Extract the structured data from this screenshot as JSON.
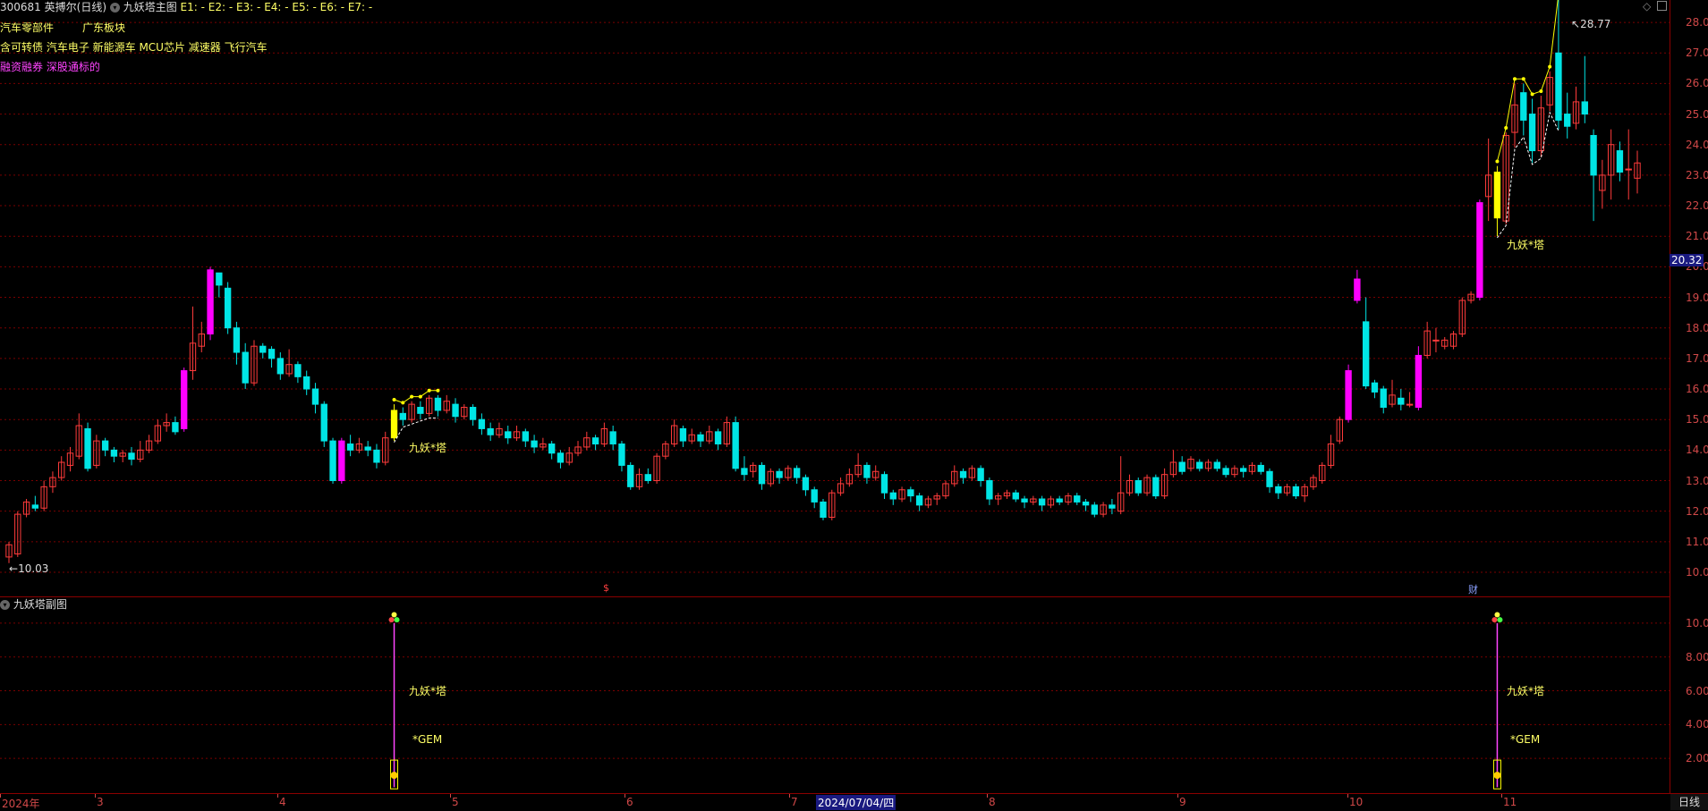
{
  "header": {
    "stock_code": "300681",
    "stock_name": "英搏尔",
    "period": "(日线)",
    "indicator": "九妖塔主图",
    "e_values": "E1: -  E2: -  E3: -  E4: -  E5: -  E6: -  E7: -"
  },
  "tags": {
    "row1a": "汽车零部件",
    "row1b": "广东板块",
    "row2": "含可转债 汽车电子 新能源车 MCU芯片 减速器 飞行汽车",
    "row3": "融资融券 深股通标的"
  },
  "colors": {
    "up": "#ff3b3b",
    "down": "#00e5e5",
    "limit_up": "#ff00ff",
    "signal": "#ffff00",
    "grid": "#7a0000",
    "axis_text": "#d04848"
  },
  "annotations": {
    "high_label": "28.77",
    "low_label": "10.03",
    "signal_label_1": "九妖*塔",
    "signal_label_2": "九妖*塔",
    "event_mark_1": "$",
    "event_mark_2": "财",
    "current_price": "20.32"
  },
  "sub_panel": {
    "title": "九妖塔副图",
    "signal_1_top": "九妖*塔",
    "signal_1_gem": "*GEM",
    "signal_2_top": "九妖*塔",
    "signal_2_gem": "*GEM",
    "axis_labels": [
      "10.00",
      "8.00",
      "6.00",
      "4.00",
      "2.00"
    ]
  },
  "price_axis": [
    "28.00",
    "27.00",
    "26.00",
    "25.00",
    "24.00",
    "23.00",
    "22.00",
    "21.00",
    "20.00",
    "19.00",
    "18.00",
    "17.00",
    "16.00",
    "15.00",
    "14.00",
    "13.00",
    "12.00",
    "11.00",
    "10.00"
  ],
  "date_axis": {
    "ticks": [
      "2024年",
      "3",
      "4",
      "5",
      "6",
      "7",
      "8",
      "9",
      "10",
      "11"
    ],
    "cursor_date": "2024/07/04/四",
    "period_button": "日线"
  },
  "chart_data": {
    "type": "candlestick",
    "title": "",
    "ylim": [
      10,
      28.5
    ],
    "signals": [
      {
        "label": "九妖*塔",
        "index": 44
      },
      {
        "label": "九妖*塔",
        "index": 170
      }
    ],
    "candles": [
      [
        10.5,
        10.9,
        10.3,
        11.0
      ],
      [
        10.6,
        11.9,
        10.5,
        12.0
      ],
      [
        11.9,
        12.3,
        11.8,
        12.4
      ],
      [
        12.2,
        12.1,
        12.0,
        12.5
      ],
      [
        12.1,
        12.8,
        12.0,
        13.0
      ],
      [
        12.8,
        13.1,
        12.6,
        13.3
      ],
      [
        13.1,
        13.6,
        13.0,
        13.8
      ],
      [
        13.5,
        13.9,
        13.3,
        14.1
      ],
      [
        13.8,
        14.8,
        13.7,
        15.2
      ],
      [
        14.7,
        13.4,
        13.3,
        14.9
      ],
      [
        13.5,
        14.3,
        13.4,
        14.5
      ],
      [
        14.3,
        14.0,
        13.8,
        14.4
      ],
      [
        14.0,
        13.8,
        13.6,
        14.1
      ],
      [
        13.8,
        13.9,
        13.6,
        14.0
      ],
      [
        13.9,
        13.7,
        13.5,
        14.1
      ],
      [
        13.7,
        14.0,
        13.6,
        14.3
      ],
      [
        14.0,
        14.3,
        13.9,
        14.5
      ],
      [
        14.3,
        14.8,
        14.2,
        15.0
      ],
      [
        14.8,
        14.9,
        14.6,
        15.2
      ],
      [
        14.9,
        14.6,
        14.5,
        15.1
      ],
      [
        14.7,
        16.6,
        14.6,
        16.7
      ],
      [
        16.6,
        17.5,
        16.3,
        18.7
      ],
      [
        17.4,
        17.8,
        17.2,
        18.2
      ],
      [
        17.8,
        19.9,
        17.6,
        20.0
      ],
      [
        19.8,
        19.4,
        19.0,
        19.7
      ],
      [
        19.3,
        18.0,
        17.8,
        19.5
      ],
      [
        18.0,
        17.2,
        16.8,
        18.2
      ],
      [
        17.2,
        16.2,
        16.0,
        17.5
      ],
      [
        16.2,
        17.4,
        16.1,
        17.6
      ],
      [
        17.4,
        17.2,
        17.0,
        17.5
      ],
      [
        17.3,
        17.0,
        16.7,
        17.4
      ],
      [
        17.0,
        16.5,
        16.3,
        17.2
      ],
      [
        16.5,
        16.8,
        16.4,
        17.3
      ],
      [
        16.8,
        16.4,
        16.2,
        16.9
      ],
      [
        16.4,
        16.0,
        15.8,
        16.6
      ],
      [
        16.0,
        15.5,
        15.2,
        16.2
      ],
      [
        15.5,
        14.3,
        14.1,
        15.6
      ],
      [
        14.3,
        13.0,
        12.9,
        14.4
      ],
      [
        13.0,
        14.3,
        12.9,
        14.4
      ],
      [
        14.2,
        14.0,
        13.8,
        14.5
      ],
      [
        14.0,
        14.2,
        13.9,
        14.4
      ],
      [
        14.1,
        14.0,
        13.8,
        14.3
      ],
      [
        14.0,
        13.6,
        13.4,
        14.2
      ],
      [
        13.6,
        14.4,
        13.5,
        14.6
      ],
      [
        14.4,
        15.3,
        14.3,
        15.5
      ],
      [
        15.2,
        15.0,
        14.8,
        15.4
      ],
      [
        15.0,
        15.5,
        14.9,
        15.6
      ],
      [
        15.4,
        15.2,
        15.0,
        15.6
      ],
      [
        15.2,
        15.7,
        15.1,
        15.8
      ],
      [
        15.7,
        15.3,
        15.1,
        15.8
      ],
      [
        15.3,
        15.6,
        15.2,
        15.8
      ],
      [
        15.5,
        15.1,
        14.9,
        15.7
      ],
      [
        15.1,
        15.4,
        15.0,
        15.5
      ],
      [
        15.4,
        15.0,
        14.8,
        15.5
      ],
      [
        15.0,
        14.7,
        14.5,
        15.2
      ],
      [
        14.7,
        14.5,
        14.3,
        14.9
      ],
      [
        14.5,
        14.7,
        14.4,
        14.9
      ],
      [
        14.6,
        14.4,
        14.2,
        14.8
      ],
      [
        14.4,
        14.6,
        14.3,
        14.8
      ],
      [
        14.6,
        14.3,
        14.1,
        14.7
      ],
      [
        14.3,
        14.1,
        13.9,
        14.5
      ],
      [
        14.1,
        14.2,
        14.0,
        14.4
      ],
      [
        14.2,
        13.9,
        13.7,
        14.3
      ],
      [
        13.9,
        13.6,
        13.4,
        14.0
      ],
      [
        13.6,
        13.9,
        13.5,
        14.1
      ],
      [
        13.9,
        14.1,
        13.8,
        14.3
      ],
      [
        14.1,
        14.4,
        14.0,
        14.6
      ],
      [
        14.4,
        14.2,
        14.0,
        14.5
      ],
      [
        14.2,
        14.7,
        14.1,
        14.9
      ],
      [
        14.6,
        14.2,
        14.0,
        14.8
      ],
      [
        14.2,
        13.5,
        13.3,
        14.3
      ],
      [
        13.5,
        12.8,
        12.7,
        13.6
      ],
      [
        12.8,
        13.2,
        12.7,
        13.4
      ],
      [
        13.2,
        13.0,
        12.9,
        13.4
      ],
      [
        13.0,
        13.8,
        12.9,
        13.9
      ],
      [
        13.8,
        14.2,
        13.7,
        14.3
      ],
      [
        14.2,
        14.8,
        14.1,
        15.0
      ],
      [
        14.7,
        14.3,
        14.1,
        14.8
      ],
      [
        14.3,
        14.5,
        14.2,
        14.7
      ],
      [
        14.5,
        14.3,
        14.1,
        14.6
      ],
      [
        14.3,
        14.6,
        14.2,
        14.8
      ],
      [
        14.6,
        14.2,
        14.0,
        14.7
      ],
      [
        14.2,
        14.9,
        14.1,
        15.1
      ],
      [
        14.9,
        13.4,
        13.3,
        15.1
      ],
      [
        13.4,
        13.2,
        13.0,
        13.8
      ],
      [
        13.3,
        13.5,
        13.1,
        13.6
      ],
      [
        13.5,
        12.9,
        12.7,
        13.6
      ],
      [
        12.9,
        13.3,
        12.8,
        13.4
      ],
      [
        13.3,
        13.1,
        12.9,
        13.4
      ],
      [
        13.1,
        13.4,
        13.0,
        13.5
      ],
      [
        13.4,
        13.1,
        12.9,
        13.5
      ],
      [
        13.1,
        12.7,
        12.5,
        13.2
      ],
      [
        12.7,
        12.3,
        12.1,
        12.8
      ],
      [
        12.3,
        11.8,
        11.7,
        12.4
      ],
      [
        11.8,
        12.6,
        11.7,
        12.7
      ],
      [
        12.6,
        12.9,
        12.5,
        13.1
      ],
      [
        12.9,
        13.2,
        12.8,
        13.4
      ],
      [
        13.2,
        13.5,
        13.1,
        13.9
      ],
      [
        13.5,
        13.1,
        12.9,
        13.6
      ],
      [
        13.1,
        13.3,
        13.0,
        13.5
      ],
      [
        13.2,
        12.6,
        12.4,
        13.3
      ],
      [
        12.6,
        12.4,
        12.2,
        12.7
      ],
      [
        12.4,
        12.7,
        12.3,
        12.8
      ],
      [
        12.7,
        12.5,
        12.3,
        12.8
      ],
      [
        12.5,
        12.2,
        12.0,
        12.6
      ],
      [
        12.2,
        12.4,
        12.1,
        12.5
      ],
      [
        12.4,
        12.5,
        12.2,
        12.6
      ],
      [
        12.5,
        12.9,
        12.4,
        13.0
      ],
      [
        12.9,
        13.3,
        12.8,
        13.5
      ],
      [
        13.3,
        13.1,
        12.9,
        13.4
      ],
      [
        13.1,
        13.4,
        13.0,
        13.5
      ],
      [
        13.4,
        13.0,
        12.8,
        13.5
      ],
      [
        13.0,
        12.4,
        12.2,
        13.1
      ],
      [
        12.4,
        12.5,
        12.2,
        12.6
      ],
      [
        12.5,
        12.6,
        12.4,
        12.7
      ],
      [
        12.6,
        12.4,
        12.3,
        12.7
      ],
      [
        12.4,
        12.3,
        12.1,
        12.5
      ],
      [
        12.3,
        12.4,
        12.2,
        12.5
      ],
      [
        12.4,
        12.2,
        12.0,
        12.5
      ],
      [
        12.2,
        12.4,
        12.1,
        12.5
      ],
      [
        12.4,
        12.3,
        12.2,
        12.5
      ],
      [
        12.3,
        12.5,
        12.2,
        12.6
      ],
      [
        12.5,
        12.3,
        12.2,
        12.6
      ],
      [
        12.3,
        12.2,
        12.0,
        12.4
      ],
      [
        12.2,
        11.9,
        11.8,
        12.3
      ],
      [
        11.9,
        12.2,
        11.8,
        12.3
      ],
      [
        12.2,
        12.1,
        11.9,
        12.4
      ],
      [
        12.0,
        12.6,
        11.9,
        13.8
      ],
      [
        12.6,
        13.0,
        12.5,
        13.2
      ],
      [
        13.0,
        12.6,
        12.5,
        13.1
      ],
      [
        12.6,
        13.1,
        12.5,
        13.2
      ],
      [
        13.1,
        12.5,
        12.4,
        13.2
      ],
      [
        12.5,
        13.2,
        12.4,
        13.4
      ],
      [
        13.2,
        13.6,
        13.1,
        14.0
      ],
      [
        13.6,
        13.3,
        13.2,
        13.8
      ],
      [
        13.4,
        13.7,
        13.3,
        13.8
      ],
      [
        13.6,
        13.4,
        13.3,
        13.7
      ],
      [
        13.4,
        13.6,
        13.3,
        13.7
      ],
      [
        13.6,
        13.4,
        13.3,
        13.7
      ],
      [
        13.4,
        13.2,
        13.1,
        13.5
      ],
      [
        13.2,
        13.4,
        13.1,
        13.5
      ],
      [
        13.4,
        13.3,
        13.1,
        13.5
      ],
      [
        13.3,
        13.5,
        13.2,
        13.6
      ],
      [
        13.5,
        13.3,
        13.2,
        13.6
      ],
      [
        13.3,
        12.8,
        12.6,
        13.4
      ],
      [
        12.8,
        12.6,
        12.4,
        12.9
      ],
      [
        12.6,
        12.8,
        12.5,
        12.9
      ],
      [
        12.8,
        12.5,
        12.4,
        12.9
      ],
      [
        12.5,
        12.8,
        12.3,
        12.9
      ],
      [
        12.8,
        13.1,
        12.7,
        13.2
      ],
      [
        13.0,
        13.5,
        12.9,
        13.6
      ],
      [
        13.5,
        14.2,
        13.4,
        14.5
      ],
      [
        14.3,
        15.0,
        14.2,
        15.1
      ],
      [
        15.0,
        16.6,
        14.9,
        16.8
      ],
      [
        18.9,
        19.6,
        18.8,
        19.9
      ],
      [
        18.2,
        16.1,
        16.0,
        19.0
      ],
      [
        16.2,
        15.9,
        15.7,
        16.3
      ],
      [
        16.0,
        15.4,
        15.2,
        16.1
      ],
      [
        15.5,
        15.8,
        15.4,
        16.3
      ],
      [
        15.7,
        15.5,
        15.3,
        16.0
      ],
      [
        15.5,
        15.5,
        15.4,
        15.9
      ],
      [
        15.4,
        17.1,
        15.3,
        17.4
      ],
      [
        17.1,
        17.9,
        17.0,
        18.2
      ],
      [
        17.6,
        17.6,
        17.2,
        18.0
      ],
      [
        17.4,
        17.6,
        17.3,
        17.7
      ],
      [
        17.4,
        17.8,
        17.3,
        17.9
      ],
      [
        17.8,
        18.9,
        17.7,
        19.0
      ],
      [
        18.9,
        19.1,
        18.8,
        19.2
      ],
      [
        19.0,
        22.1,
        18.9,
        22.2
      ],
      [
        22.3,
        23.0,
        21.5,
        24.2
      ],
      [
        21.6,
        23.1,
        21.0,
        23.3
      ],
      [
        21.5,
        24.3,
        21.4,
        24.4
      ],
      [
        24.4,
        25.3,
        23.9,
        26.0
      ],
      [
        25.7,
        24.8,
        24.3,
        26.0
      ],
      [
        25.0,
        23.8,
        23.4,
        25.5
      ],
      [
        23.8,
        25.2,
        23.6,
        25.6
      ],
      [
        25.3,
        26.2,
        25.1,
        26.4
      ],
      [
        27.0,
        24.8,
        24.5,
        28.77
      ],
      [
        25.0,
        24.6,
        24.2,
        25.7
      ],
      [
        24.7,
        25.4,
        24.5,
        25.9
      ],
      [
        25.4,
        25.0,
        24.7,
        26.9
      ],
      [
        24.3,
        23.0,
        21.5,
        24.5
      ],
      [
        22.5,
        23.0,
        21.9,
        23.5
      ],
      [
        23.0,
        24.0,
        22.2,
        24.5
      ],
      [
        23.8,
        23.1,
        22.8,
        24.1
      ],
      [
        23.2,
        23.2,
        22.2,
        24.5
      ],
      [
        22.9,
        23.4,
        22.4,
        23.8
      ]
    ]
  }
}
